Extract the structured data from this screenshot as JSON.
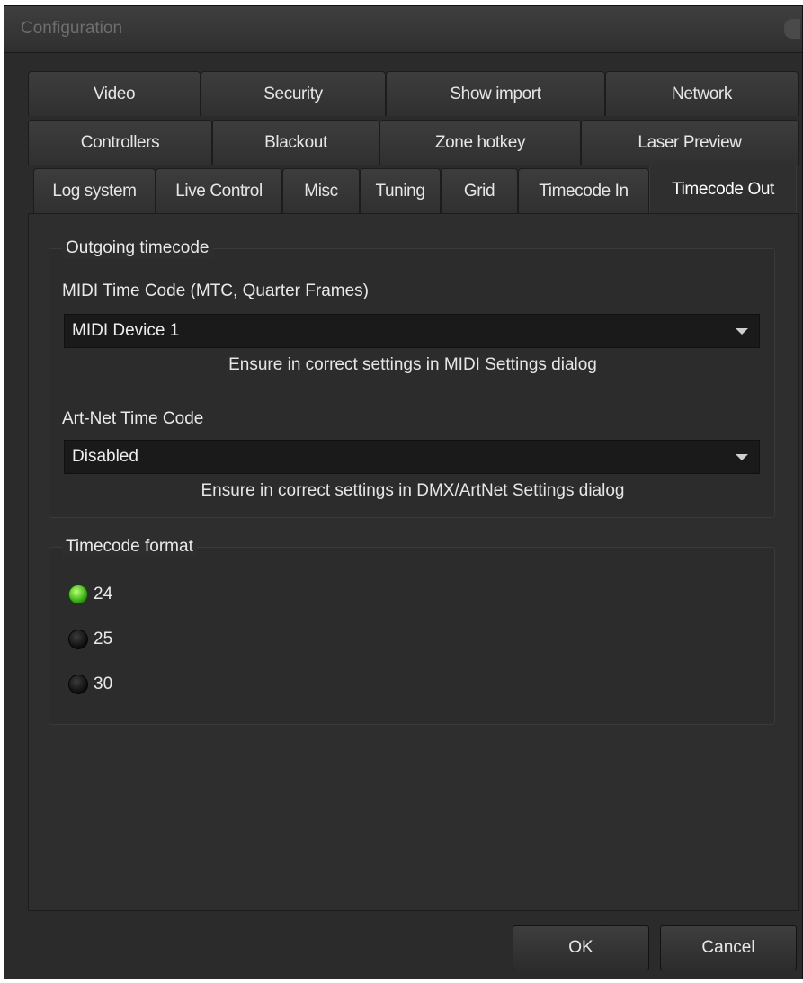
{
  "window": {
    "title": "Configuration"
  },
  "tabs": {
    "row1": [
      "Video",
      "Security",
      "Show import",
      "Network"
    ],
    "row2": [
      "Controllers",
      "Blackout",
      "Zone hotkey",
      "Laser Preview"
    ],
    "row3": [
      "Log system",
      "Live Control",
      "Misc",
      "Tuning",
      "Grid",
      "Timecode In",
      "Timecode Out"
    ],
    "active": "Timecode Out"
  },
  "outgoing": {
    "group_label": "Outgoing timecode",
    "mtc_label": "MIDI Time Code (MTC, Quarter Frames)",
    "mtc_value": "MIDI Device 1",
    "mtc_hint": "Ensure in correct settings in MIDI Settings dialog",
    "artnet_label": "Art-Net Time Code",
    "artnet_value": "Disabled",
    "artnet_hint": "Ensure in correct settings in DMX/ArtNet Settings dialog"
  },
  "format": {
    "group_label": "Timecode format",
    "options": [
      "24",
      "25",
      "30"
    ],
    "selected": "24"
  },
  "buttons": {
    "ok": "OK",
    "cancel": "Cancel"
  },
  "colors": {
    "radio_selected": "#3fb51b",
    "background": "#2b2b2b"
  }
}
